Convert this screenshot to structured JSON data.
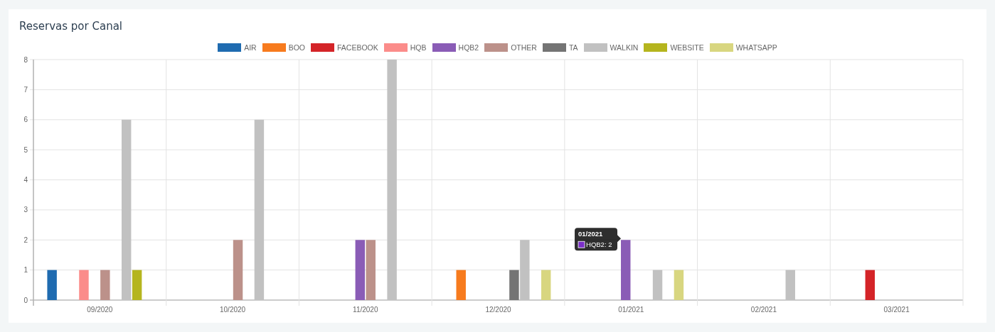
{
  "card": {
    "title": "Reservas por Canal"
  },
  "chart_data": {
    "type": "bar",
    "categories": [
      "09/2020",
      "10/2020",
      "11/2020",
      "12/2020",
      "01/2021",
      "02/2021",
      "03/2021"
    ],
    "ylim": [
      0,
      8
    ],
    "yticks": [
      0,
      1,
      2,
      3,
      4,
      5,
      6,
      7,
      8
    ],
    "series": [
      {
        "name": "AIR",
        "color": "#1f6bb0",
        "values": [
          1,
          0,
          0,
          0,
          0,
          0,
          0
        ]
      },
      {
        "name": "BOO",
        "color": "#f77b1e",
        "values": [
          0,
          0,
          0,
          1,
          0,
          0,
          0
        ]
      },
      {
        "name": "FACEBOOK",
        "color": "#d42428",
        "values": [
          0,
          0,
          0,
          0,
          0,
          0,
          1
        ]
      },
      {
        "name": "HQB",
        "color": "#fb8c8a",
        "values": [
          1,
          0,
          0,
          0,
          0,
          0,
          0
        ]
      },
      {
        "name": "HQB2",
        "color": "#8a5cb6",
        "values": [
          0,
          0,
          2,
          0,
          2,
          0,
          0
        ]
      },
      {
        "name": "OTHER",
        "color": "#bc918a",
        "values": [
          1,
          2,
          2,
          0,
          0,
          0,
          0
        ]
      },
      {
        "name": "TA",
        "color": "#747474",
        "values": [
          0,
          0,
          0,
          1,
          0,
          0,
          0
        ]
      },
      {
        "name": "WALKIN",
        "color": "#c1c1c1",
        "values": [
          6,
          6,
          8,
          2,
          1,
          1,
          0
        ]
      },
      {
        "name": "WEBSITE",
        "color": "#b5b51e",
        "values": [
          1,
          0,
          0,
          0,
          0,
          0,
          0
        ]
      },
      {
        "name": "WHATSAPP",
        "color": "#d8d680",
        "values": [
          0,
          0,
          0,
          1,
          1,
          0,
          0
        ]
      }
    ],
    "grid": true
  },
  "tooltip": {
    "title": "01/2021",
    "label": "HQB2: 2",
    "color": "#7b2fc8"
  }
}
